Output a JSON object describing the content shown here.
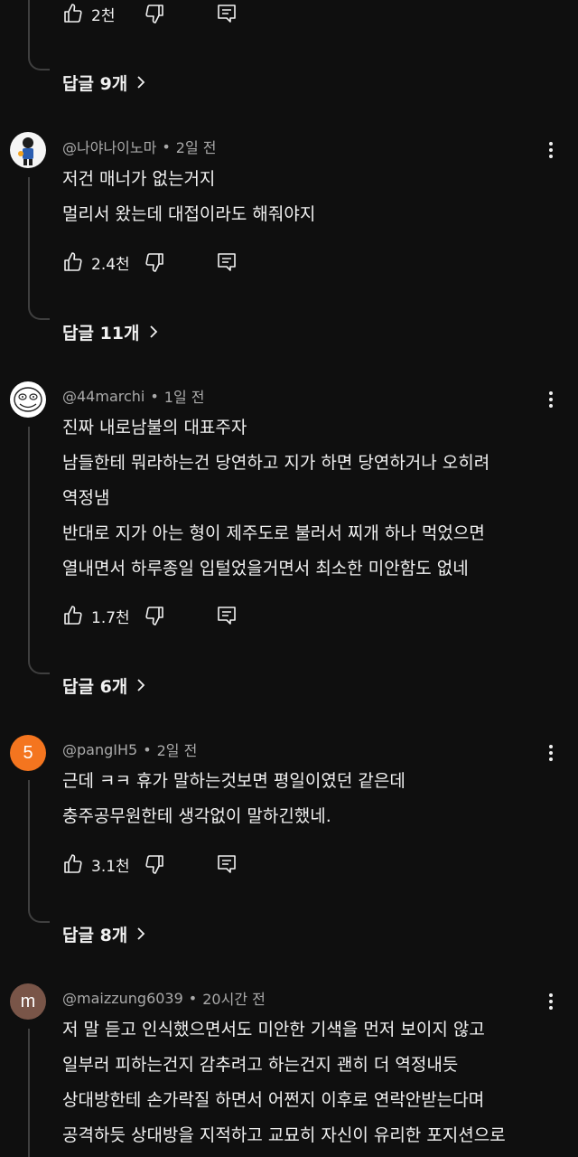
{
  "comment0": {
    "likes": "2천",
    "replies": "답글 9개"
  },
  "comments": [
    {
      "author": "@나야나이노마",
      "time": "2일 전",
      "avatar_kind": "figure",
      "lines": [
        "저건 매너가 없는거지",
        "멀리서 왔는데 대접이라도 해줘야지"
      ],
      "likes": "2.4천",
      "replies": "답글 11개"
    },
    {
      "author": "@44marchi",
      "time": "1일 전",
      "avatar_kind": "face",
      "lines": [
        "진짜 내로남불의 대표주자",
        "남들한테 뭐라하는건 당연하고 지가 하면 당연하거나 오히려",
        "역정냄",
        "반대로 지가 아는 형이 제주도로 불러서 찌개 하나 먹었으면",
        "열내면서 하루종일 입털었을거면서 최소한 미안함도 없네"
      ],
      "likes": "1.7천",
      "replies": "답글 6개"
    },
    {
      "author": "@pangIH5",
      "time": "2일 전",
      "avatar_kind": "letter",
      "avatar_letter": "5",
      "avatar_color": "#f4751f",
      "lines": [
        "근데 ㅋㅋ 휴가 말하는것보면 평일이였던 같은데",
        "충주공무원한테 생각없이 말하긴했네."
      ],
      "likes": "3.1천",
      "replies": "답글 8개"
    },
    {
      "author": "@maizzung6039",
      "time": "20시간 전",
      "avatar_kind": "letter",
      "avatar_letter": "m",
      "avatar_color": "#795548",
      "lines": [
        "저 말 듣고 인식했으면서도 미안한 기색을 먼저 보이지 않고",
        "일부러 피하는건지 감추려고 하는건지 괜히 더 역정내듯",
        "상대방한테 손가락질 하면서 어쩐지 이후로 연락안받는다며",
        "공격하듯 상대방을 지적하고 교묘히 자신이 유리한 포지션으로"
      ]
    }
  ],
  "icons": {
    "like": "thumb-up-icon",
    "dislike": "thumb-down-icon",
    "reply": "comment-reply-icon",
    "menu": "more-vert-icon",
    "chevron": "chevron-right-icon"
  }
}
